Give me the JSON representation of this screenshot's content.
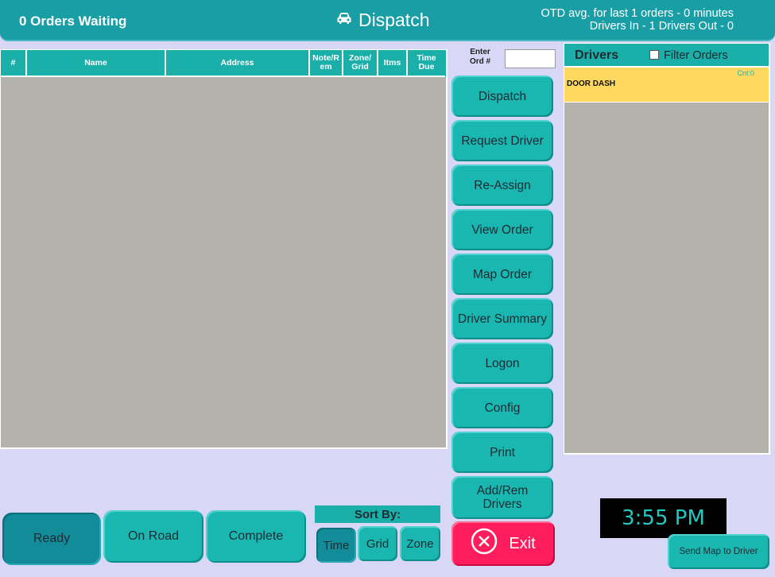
{
  "header": {
    "orders_waiting": "0 Orders Waiting",
    "title": "Dispatch",
    "title_icon": "car-icon",
    "otd_line": "OTD avg. for last 1 orders - 0 minutes",
    "drivers_line": "Drivers In - 1   Drivers Out - 0"
  },
  "orders_table": {
    "columns": [
      "#",
      "Name",
      "Address",
      "Note/R em",
      "Zone/ Grid",
      "Itms",
      "Time Due"
    ],
    "rows": []
  },
  "order_lookup": {
    "label": "Enter Ord #",
    "value": ""
  },
  "actions": [
    "Dispatch",
    "Request Driver",
    "Re-Assign",
    "View Order",
    "Map Order",
    "Driver Summary",
    "Logon",
    "Config",
    "Print",
    "Add/Rem Drivers"
  ],
  "exit": {
    "label": "Exit",
    "icon": "close-circle-icon"
  },
  "drivers": {
    "title": "Drivers",
    "filter_label": "Filter Orders",
    "filter_checked": false,
    "list": [
      {
        "name": "DOOR DASH",
        "count": "Cnt:0"
      }
    ]
  },
  "status_tabs": {
    "ready": "Ready",
    "on_road": "On Road",
    "complete": "Complete",
    "selected": "Ready"
  },
  "sort": {
    "label": "Sort By:",
    "time": "Time",
    "grid": "Grid",
    "zone": "Zone",
    "selected": "Time"
  },
  "clock": "3:55 PM",
  "send_map": "Send Map to Driver",
  "colors": {
    "accent": "#1ab6b0",
    "header": "#1a9ea6",
    "background": "#d8d8f6",
    "panel": "#b3b3ab",
    "driver_highlight": "#ffd95f",
    "exit": "#ff1d5e"
  }
}
